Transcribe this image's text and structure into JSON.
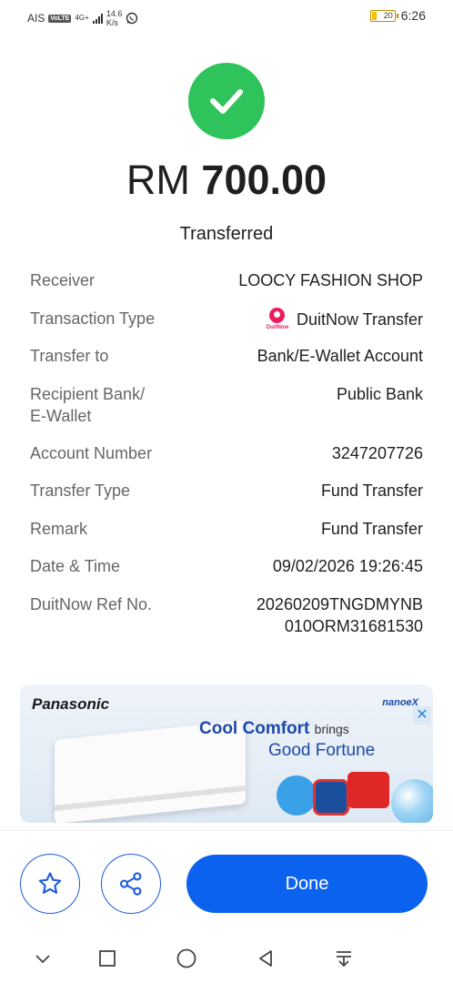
{
  "status_bar": {
    "carrier": "AIS",
    "volte": "VoLTE",
    "network": "4G+",
    "speed_value": "14.6",
    "speed_unit": "K/s",
    "battery": "20",
    "time": "6:26"
  },
  "colors": {
    "success": "#2fc35b",
    "primary": "#0b62ee",
    "duitnow": "#ed1c5f"
  },
  "transaction": {
    "currency": "RM",
    "amount": "700.00",
    "status": "Transferred"
  },
  "details": [
    {
      "label": "Receiver",
      "value": "LOOCY FASHION SHOP"
    },
    {
      "label": "Transaction Type",
      "value": "DuitNow Transfer",
      "icon": "duitnow-logo",
      "icon_text": "DuitNow"
    },
    {
      "label": "Transfer to",
      "value": "Bank/E-Wallet Account"
    },
    {
      "label": "Recipient Bank/",
      "label_line2": "E-Wallet",
      "value": "Public Bank"
    },
    {
      "label": "Account Number",
      "value": "3247207726"
    },
    {
      "label": "Transfer Type",
      "value": "Fund Transfer"
    },
    {
      "label": "Remark",
      "value": "Fund Transfer"
    },
    {
      "label": "Date & Time",
      "value": "09/02/2026 19:26:45"
    },
    {
      "label": "DuitNow Ref No.",
      "value": "20260209TNGDMYNB",
      "value_line2": "010ORM31681530"
    }
  ],
  "ad": {
    "brand": "Panasonic",
    "tag": "nanoeX",
    "close": "✕",
    "headline_bold": "Cool Comfort",
    "headline_rest": "brings",
    "headline_line2": "Good Fortune"
  },
  "actions": {
    "done_label": "Done",
    "favorite_icon": "star-icon",
    "share_icon": "share-icon"
  },
  "nav": [
    "chevron-down-icon",
    "square-icon",
    "circle-icon",
    "back-triangle-icon",
    "download-icon"
  ]
}
